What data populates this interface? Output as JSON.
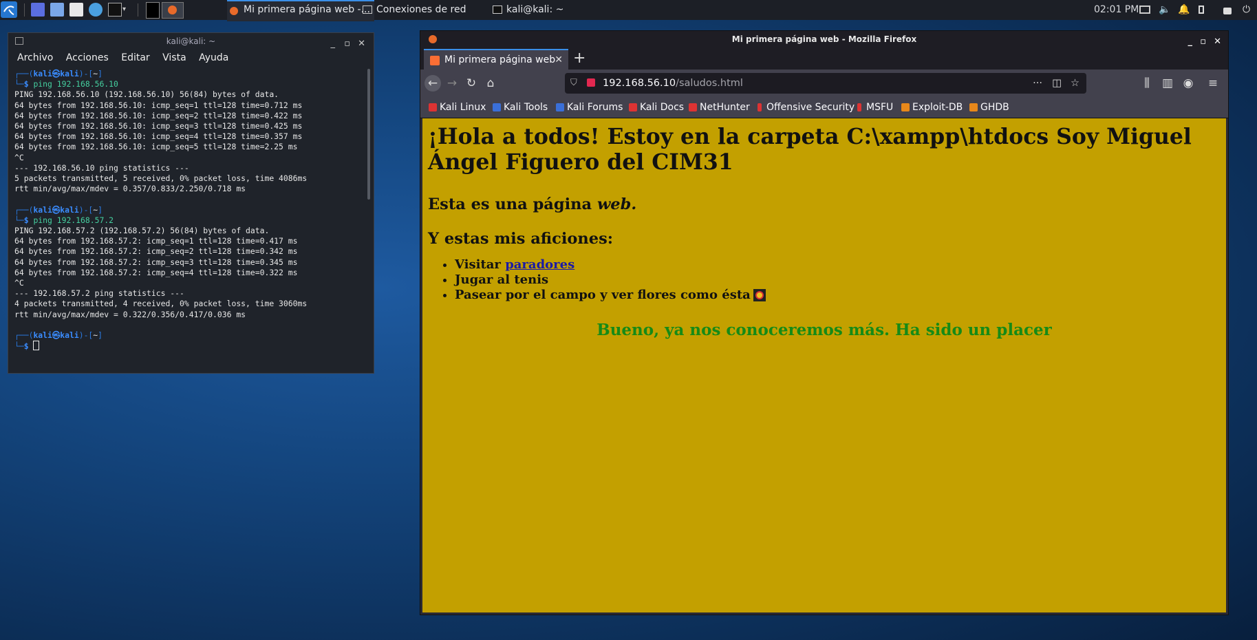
{
  "taskbar": {
    "tasks": [
      {
        "label": "Mi primera página web -..."
      },
      {
        "label": "Conexiones de red"
      },
      {
        "label": "kali@kali: ~"
      }
    ],
    "clock": "02:01 PM"
  },
  "terminal": {
    "title": "kali@kali: ~",
    "menu": [
      "Archivo",
      "Acciones",
      "Editar",
      "Vista",
      "Ayuda"
    ],
    "prompt_user": "kali",
    "prompt_host": "kali",
    "prompt_dir": "~",
    "sessions": [
      {
        "command": "ping 192.168.56.10",
        "output": [
          "PING 192.168.56.10 (192.168.56.10) 56(84) bytes of data.",
          "64 bytes from 192.168.56.10: icmp_seq=1 ttl=128 time=0.712 ms",
          "64 bytes from 192.168.56.10: icmp_seq=2 ttl=128 time=0.422 ms",
          "64 bytes from 192.168.56.10: icmp_seq=3 ttl=128 time=0.425 ms",
          "64 bytes from 192.168.56.10: icmp_seq=4 ttl=128 time=0.357 ms",
          "64 bytes from 192.168.56.10: icmp_seq=5 ttl=128 time=2.25 ms",
          "^C",
          "--- 192.168.56.10 ping statistics ---",
          "5 packets transmitted, 5 received, 0% packet loss, time 4086ms",
          "rtt min/avg/max/mdev = 0.357/0.833/2.250/0.718 ms"
        ]
      },
      {
        "command": "ping 192.168.57.2",
        "output": [
          "PING 192.168.57.2 (192.168.57.2) 56(84) bytes of data.",
          "64 bytes from 192.168.57.2: icmp_seq=1 ttl=128 time=0.417 ms",
          "64 bytes from 192.168.57.2: icmp_seq=2 ttl=128 time=0.342 ms",
          "64 bytes from 192.168.57.2: icmp_seq=3 ttl=128 time=0.345 ms",
          "64 bytes from 192.168.57.2: icmp_seq=4 ttl=128 time=0.322 ms",
          "^C",
          "--- 192.168.57.2 ping statistics ---",
          "4 packets transmitted, 4 received, 0% packet loss, time 3060ms",
          "rtt min/avg/max/mdev = 0.322/0.356/0.417/0.036 ms"
        ]
      }
    ]
  },
  "firefox": {
    "window_title": "Mi primera página web - Mozilla Firefox",
    "tab_title": "Mi primera página web",
    "url_host": "192.168.56.10",
    "url_path": "/saludos.html",
    "bookmarks": [
      {
        "label": "Kali Linux",
        "color": "#d33"
      },
      {
        "label": "Kali Tools",
        "color": "#3a6fd8"
      },
      {
        "label": "Kali Forums",
        "color": "#3a6fd8"
      },
      {
        "label": "Kali Docs",
        "color": "#d33"
      },
      {
        "label": "NetHunter",
        "color": "#d33"
      },
      {
        "label": "Offensive Security",
        "color": "#d33"
      },
      {
        "label": "MSFU",
        "color": "#d33"
      },
      {
        "label": "Exploit-DB",
        "color": "#e8881a"
      },
      {
        "label": "GHDB",
        "color": "#e8881a"
      }
    ],
    "page": {
      "heading": "¡Hola a todos! Estoy en la carpeta C:\\xampp\\htdocs Soy Miguel Ángel Figuero del CIM31",
      "subheading_text": "Esta es una página ",
      "subheading_em": "web.",
      "hobbies_heading": "Y estas mis aficiones:",
      "hobby1_text": "Visitar ",
      "hobby1_link": "paradores",
      "hobby2": "Jugar al tenis",
      "hobby3": "Pasear por el campo y ver flores como ésta",
      "closing": "Bueno, ya nos conoceremos más. Ha sido un placer",
      "background": "#c3a000",
      "closing_color": "#168a16"
    }
  }
}
